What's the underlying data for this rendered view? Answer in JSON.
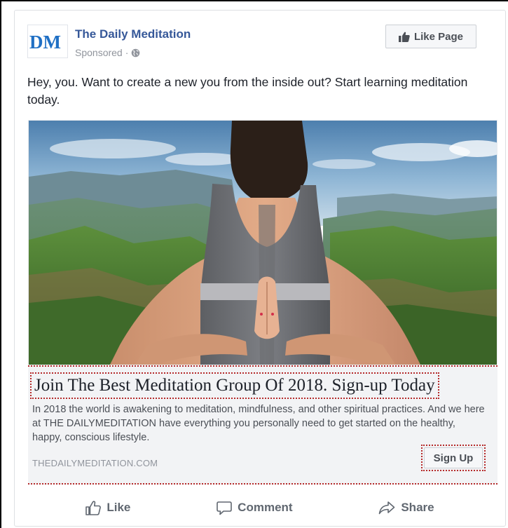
{
  "header": {
    "page_name": "The Daily Meditation",
    "sponsored_label": "Sponsored",
    "separator": "·",
    "logo_text": "DM",
    "like_page_label": "Like Page"
  },
  "post": {
    "text": "Hey, you. Want to create a new you from the inside out? Start learning meditation today."
  },
  "link": {
    "headline": "Join The Best Meditation Group Of 2018. Sign-up Today",
    "description": "In 2018 the world is awakening to meditation, mindfulness, and other spiritual practices. And we here at THE DAILYMEDITATION have everything you personally need to get started on the healthy, happy, conscious lifestyle.",
    "domain": "THEDAILYMEDITATION.COM",
    "cta_label": "Sign Up"
  },
  "actions": {
    "like": "Like",
    "comment": "Comment",
    "share": "Share"
  },
  "colors": {
    "brand_blue": "#365899",
    "logo_blue": "#1f6fc4",
    "highlight_red": "#b52a2a",
    "muted_gray": "#90949c"
  },
  "icons": [
    "globe-icon",
    "thumbs-up-icon",
    "like-icon",
    "comment-icon",
    "share-icon"
  ]
}
